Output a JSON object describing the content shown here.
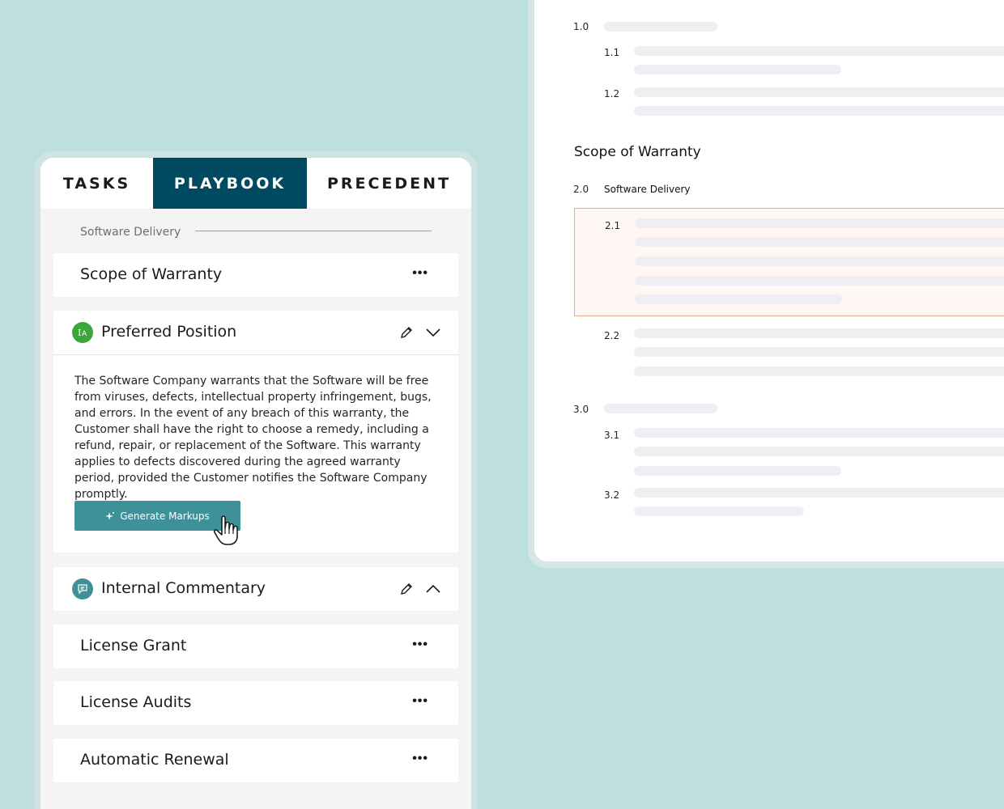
{
  "document": {
    "sections": [
      {
        "number": "1.0",
        "subsections": [
          {
            "number": "1.1"
          },
          {
            "number": "1.2"
          }
        ]
      },
      {
        "number": "3.0",
        "subsections": [
          {
            "number": "3.1"
          },
          {
            "number": "3.2"
          }
        ]
      }
    ],
    "heading": "Scope of Warranty",
    "subheading_number": "2.0",
    "subheading": "Software Delivery",
    "highlighted_number": "2.1",
    "next_number": "2.2",
    "highlight_border_color": "#e8a88a"
  },
  "panel": {
    "tabs": [
      {
        "label": "TASKS",
        "active": false
      },
      {
        "label": "PLAYBOOK",
        "active": true
      },
      {
        "label": "PRECEDENT",
        "active": false
      }
    ],
    "section_label": "Software Delivery",
    "scope_card": {
      "title": "Scope of Warranty",
      "more": "•••"
    },
    "preferred": {
      "title": "Preferred Position",
      "icon": "text-edit-icon",
      "body": "The Software Company warrants that the Software will be free from viruses, defects, intellectual property infringement, bugs, and errors. In the event of any breach of this warranty, the Customer shall have the right to choose a remedy, including a refund, repair, or replacement of the Software. This warranty applies to defects discovered during the agreed warranty period, provided the Customer notifies the Software Company promptly.",
      "button_label": "Generate Markups"
    },
    "commentary": {
      "title": "Internal Commentary",
      "icon": "comment-icon"
    },
    "items": [
      {
        "title": "License Grant",
        "more": "•••"
      },
      {
        "title": "License Audits",
        "more": "•••"
      },
      {
        "title": "Automatic Renewal",
        "more": "•••"
      }
    ]
  },
  "colors": {
    "background": "#bde0df",
    "tab_active": "#004a61",
    "button": "#3f9199",
    "badge_green": "#3ba63a",
    "badge_teal": "#3f9199"
  }
}
